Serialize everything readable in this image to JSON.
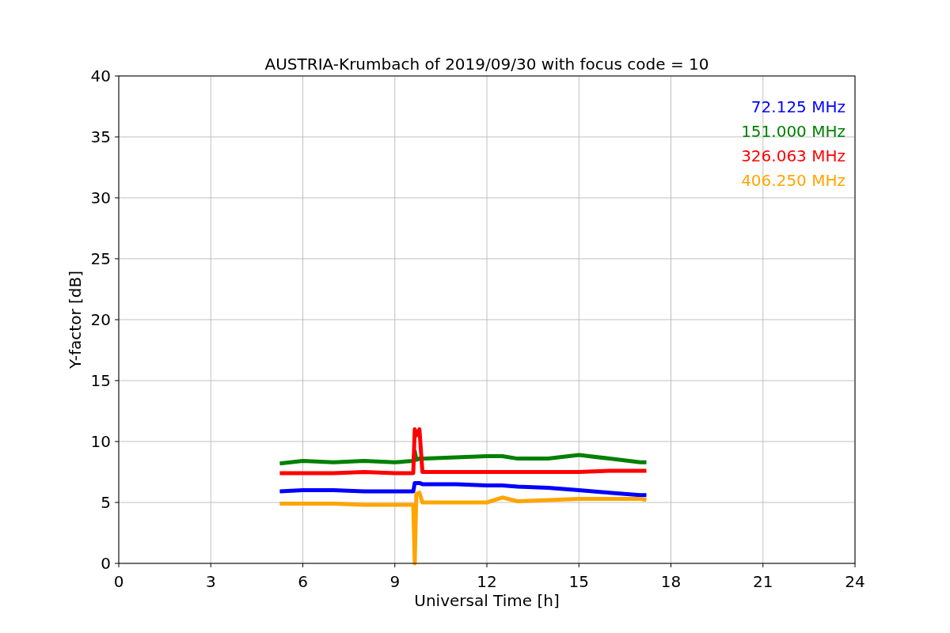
{
  "chart_data": {
    "type": "line",
    "title": "AUSTRIA-Krumbach of 2019/09/30 with focus code = 10",
    "xlabel": "Universal Time [h]",
    "ylabel": "Y-factor [dB]",
    "x": [
      5.25,
      6,
      7,
      8,
      9,
      9.6,
      9.65,
      9.7,
      9.8,
      9.9,
      10,
      11,
      12,
      12.5,
      13,
      14,
      15,
      16,
      17,
      17.2
    ],
    "series": [
      {
        "name": "72.125 MHz",
        "color": "#0000ff",
        "values": [
          5.9,
          6.0,
          6.0,
          5.9,
          5.9,
          5.9,
          6.6,
          6.6,
          6.6,
          6.5,
          6.5,
          6.5,
          6.4,
          6.4,
          6.3,
          6.2,
          6.0,
          5.8,
          5.6,
          5.6
        ]
      },
      {
        "name": "151.000 MHz",
        "color": "#008000",
        "values": [
          8.2,
          8.4,
          8.3,
          8.4,
          8.3,
          8.4,
          9.2,
          8.5,
          8.6,
          8.6,
          8.6,
          8.7,
          8.8,
          8.8,
          8.6,
          8.6,
          8.9,
          8.6,
          8.3,
          8.3
        ]
      },
      {
        "name": "326.063 MHz",
        "color": "#ff0000",
        "values": [
          7.4,
          7.4,
          7.4,
          7.5,
          7.4,
          7.4,
          11.0,
          10.5,
          11.0,
          7.5,
          7.5,
          7.5,
          7.5,
          7.5,
          7.5,
          7.5,
          7.5,
          7.6,
          7.6,
          7.6
        ]
      },
      {
        "name": "406.250 MHz",
        "color": "#ffa500",
        "values": [
          4.9,
          4.9,
          4.9,
          4.8,
          4.8,
          4.8,
          0,
          5.7,
          5.8,
          5.0,
          5.0,
          5.0,
          5.0,
          5.4,
          5.1,
          5.2,
          5.3,
          5.3,
          5.3,
          5.2
        ]
      }
    ],
    "xlim": [
      0,
      24
    ],
    "ylim": [
      0,
      40
    ],
    "xticks": [
      0,
      3,
      6,
      9,
      12,
      15,
      18,
      21,
      24
    ],
    "yticks": [
      0,
      5,
      10,
      15,
      20,
      25,
      30,
      35,
      40
    ],
    "grid": true
  }
}
